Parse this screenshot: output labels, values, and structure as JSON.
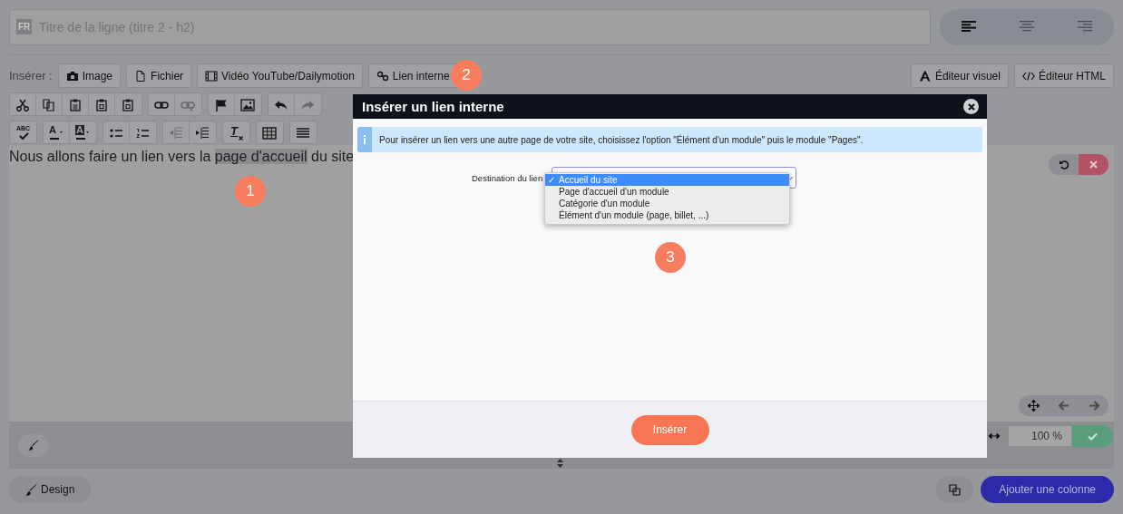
{
  "title_field": {
    "language": "FR",
    "placeholder": "Titre de la ligne (titre 2 - h2)"
  },
  "alignment": [
    {
      "kind": "left",
      "selected": true
    },
    {
      "kind": "center",
      "selected": false
    },
    {
      "kind": "right",
      "selected": false
    }
  ],
  "insert_bar": {
    "label": "Insérer :",
    "buttons": [
      {
        "kind": "camera",
        "label": "Image"
      },
      {
        "kind": "file",
        "label": "Fichier"
      },
      {
        "kind": "film",
        "label": "Vidéo YouTube/Dailymotion"
      },
      {
        "kind": "link",
        "label": "Lien interne"
      }
    ]
  },
  "editor_modes": [
    {
      "kind": "font",
      "label": "Éditeur visuel"
    },
    {
      "kind": "code",
      "label": "Éditeur HTML"
    }
  ],
  "toolbar": [
    [
      [
        {
          "kind": "cut",
          "disabled": false
        },
        {
          "kind": "copy",
          "disabled": false
        },
        {
          "kind": "paste",
          "disabled": false
        },
        {
          "kind": "paste-text",
          "disabled": false
        },
        {
          "kind": "paste-word",
          "disabled": false
        }
      ],
      [
        {
          "kind": "link",
          "disabled": false
        },
        {
          "kind": "unlink",
          "disabled": true
        }
      ],
      [
        {
          "kind": "flag",
          "disabled": false
        },
        {
          "kind": "image",
          "disabled": false
        }
      ],
      [
        {
          "kind": "undo",
          "disabled": false
        },
        {
          "kind": "redo",
          "disabled": true
        }
      ]
    ],
    [
      [
        {
          "kind": "spellcheck",
          "glyph": "ABC",
          "disabled": false
        }
      ],
      [
        {
          "kind": "text-color",
          "glyph": "A",
          "disabled": false
        },
        {
          "kind": "bg-color",
          "glyph": "A",
          "disabled": false
        }
      ],
      [
        {
          "kind": "bullets",
          "disabled": false
        },
        {
          "kind": "numbers",
          "disabled": false
        }
      ],
      [
        {
          "kind": "outdent",
          "disabled": true
        },
        {
          "kind": "indent",
          "disabled": false
        }
      ],
      [
        {
          "kind": "clear-format",
          "glyph": "T",
          "disabled": false
        }
      ],
      [
        {
          "kind": "table",
          "disabled": false
        }
      ],
      [
        {
          "kind": "rule",
          "disabled": false
        }
      ]
    ]
  ],
  "content": {
    "before": "Nous allons faire un lien vers la ",
    "highlight": "page d'accueil",
    "after": " du site"
  },
  "width_value": "100 %",
  "footer": {
    "design": "Design",
    "add_column": "Ajouter une colonne"
  },
  "modal": {
    "title": "Insérer un lien interne",
    "info": "Pour insérer un lien vers une autre page de votre site, choisissez l'option \"Élément d'un module\" puis le module \"Pages\".",
    "field_label": "Destination du lien",
    "check": "✓",
    "options": [
      {
        "label": "Accueil du site",
        "selected": true
      },
      {
        "label": "Page d'accueil d'un module",
        "selected": false
      },
      {
        "label": "Catégorie d'un module",
        "selected": false
      },
      {
        "label": "Élément d'un module (page, billet, ...)",
        "selected": false
      }
    ],
    "submit": "Insérer"
  },
  "badges": [
    "1",
    "2",
    "3"
  ]
}
